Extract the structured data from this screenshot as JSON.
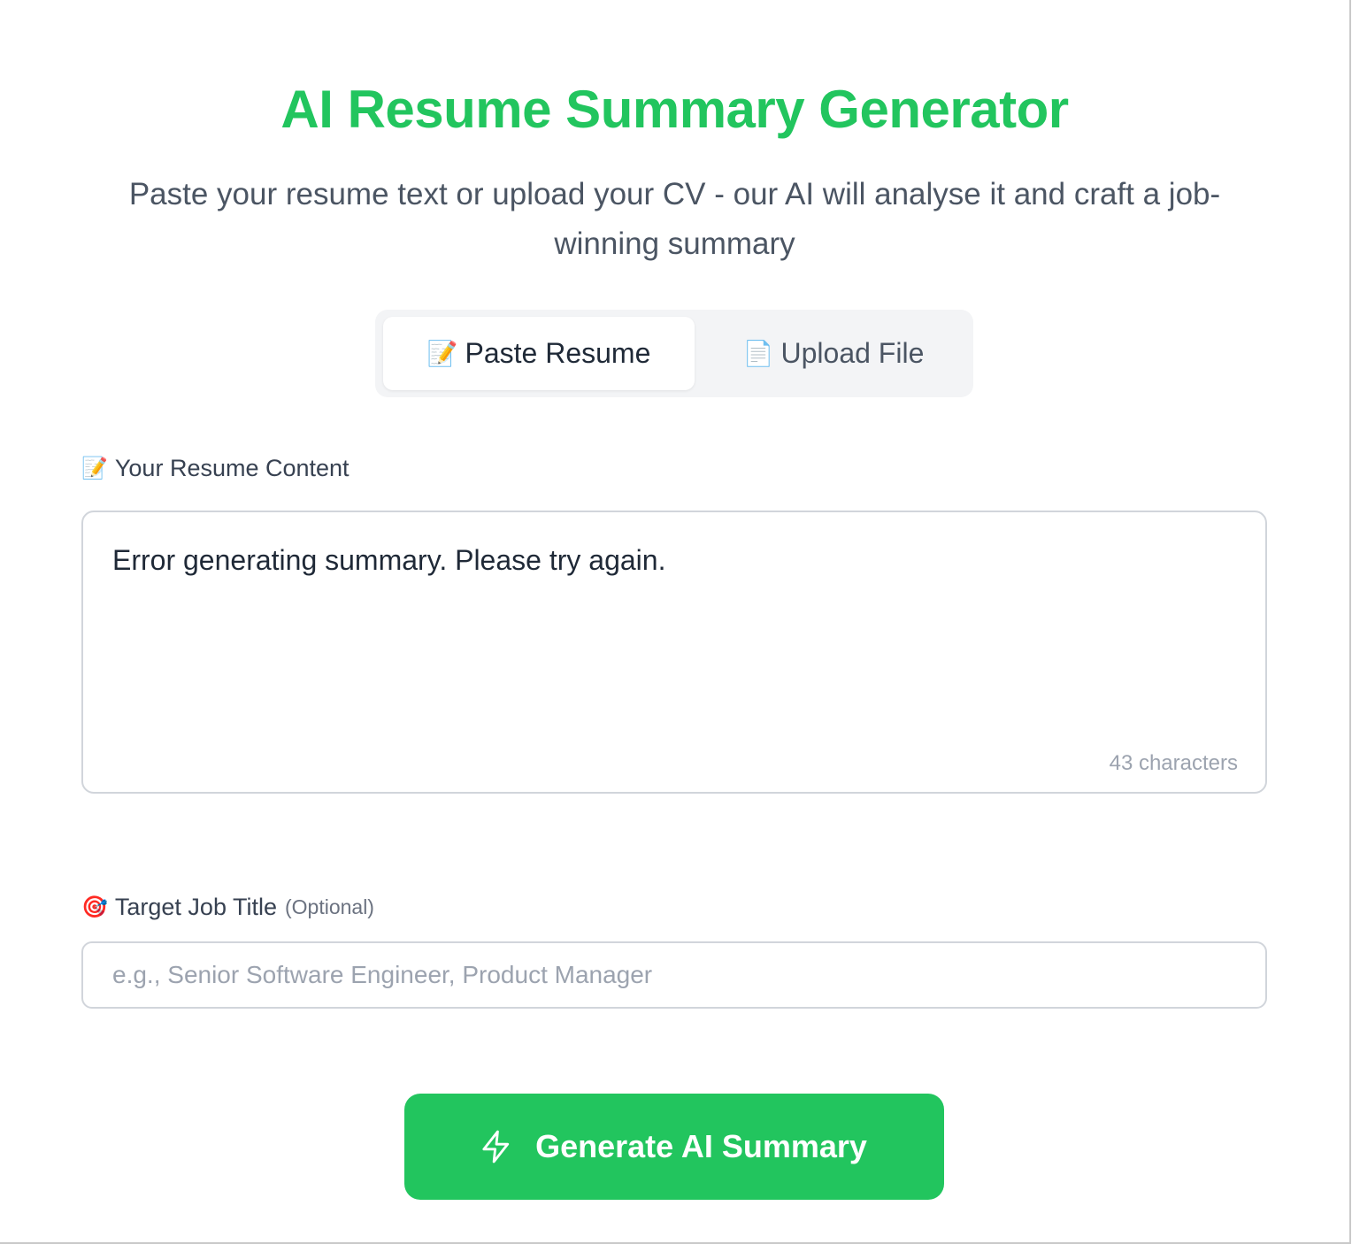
{
  "header": {
    "title": "AI Resume Summary Generator",
    "subtitle": "Paste your resume text or upload your CV - our AI will analyse it and craft a job-winning summary"
  },
  "tabs": [
    {
      "icon": "memo-icon",
      "emoji": "📝",
      "label": "Paste Resume",
      "active": true
    },
    {
      "icon": "page-icon",
      "emoji": "📄",
      "label": "Upload File",
      "active": false
    }
  ],
  "resume_field": {
    "emoji": "📝",
    "label": "Your Resume Content",
    "value": "Error generating summary. Please try again.",
    "char_count": "43 characters"
  },
  "job_field": {
    "emoji": "🎯",
    "label": "Target Job Title",
    "optional": "(Optional)",
    "placeholder": "e.g., Senior Software Engineer, Product Manager"
  },
  "generate_button": {
    "icon": "lightning-icon",
    "label": "Generate AI Summary"
  },
  "colors": {
    "accent": "#22c55e",
    "text": "#1f2937",
    "muted": "#9ca3af"
  }
}
